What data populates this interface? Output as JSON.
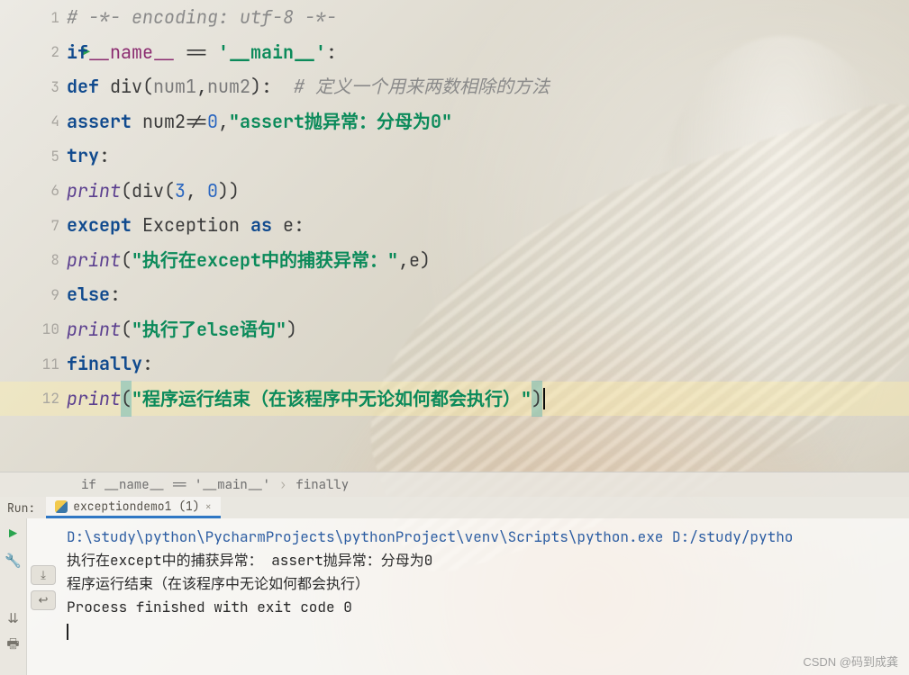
{
  "gutter": {
    "lines": [
      "1",
      "2",
      "3",
      "4",
      "5",
      "6",
      "7",
      "8",
      "9",
      "10",
      "11",
      "12"
    ],
    "run_marker_line": 2,
    "fold_marker_line": 12
  },
  "code": {
    "l1_comment": "# -*- encoding: utf-8 -*-",
    "l2_kw_if": "if",
    "l2_dunder": "__name__",
    "l2_eq": " == ",
    "l2_str": "'__main__'",
    "l2_colon": ":",
    "l3_def": "def",
    "l3_fn": " div",
    "l3_open": "(",
    "l3_p1": "num1",
    "l3_comma": ",",
    "l3_p2": "num2",
    "l3_close": ")",
    "l3_colon": ":",
    "l3_comment": "  # 定义一个用来两数相除的方法",
    "l4_assert": "assert",
    "l4_expr_a": " num2",
    "l4_ne": "!=",
    "l4_zero": "0",
    "l4_comma": ",",
    "l4_str": "\"assert抛异常：分母为0\"",
    "l5_try": "try",
    "l5_colon": ":",
    "l6_print": "print",
    "l6_open": "(",
    "l6_fn": "div",
    "l6_open2": "(",
    "l6_a": "3",
    "l6_c": ", ",
    "l6_b": "0",
    "l6_close2": ")",
    "l6_close": ")",
    "l7_except": "except",
    "l7_exc": " Exception ",
    "l7_as": "as",
    "l7_e": " e",
    "l7_colon": ":",
    "l8_print": "print",
    "l8_open": "(",
    "l8_str": "\"执行在except中的捕获异常：\"",
    "l8_c": ",",
    "l8_e": "e",
    "l8_close": ")",
    "l9_else": "else",
    "l9_colon": ":",
    "l10_print": "print",
    "l10_open": "(",
    "l10_str": "\"执行了else语句\"",
    "l10_close": ")",
    "l11_fin": "finally",
    "l11_colon": ":",
    "l12_print": "print",
    "l12_open": "(",
    "l12_str": "\"程序运行结束（在该程序中无论如何都会执行）\"",
    "l12_close": ")"
  },
  "breadcrumb": {
    "seg1": "if __name__ == '__main__'",
    "seg2": "finally"
  },
  "runbar": {
    "label": "Run:",
    "tab_name": "exceptiondemo1 (1)"
  },
  "console": {
    "cmd": "D:\\study\\python\\PycharmProjects\\pythonProject\\venv\\Scripts\\python.exe D:/study/pytho",
    "line2": "执行在except中的捕获异常：  assert抛异常：分母为0",
    "line3": "程序运行结束（在该程序中无论如何都会执行）",
    "blank": "",
    "exitline": "Process finished with exit code 0"
  },
  "watermark": "CSDN @码到成龚"
}
